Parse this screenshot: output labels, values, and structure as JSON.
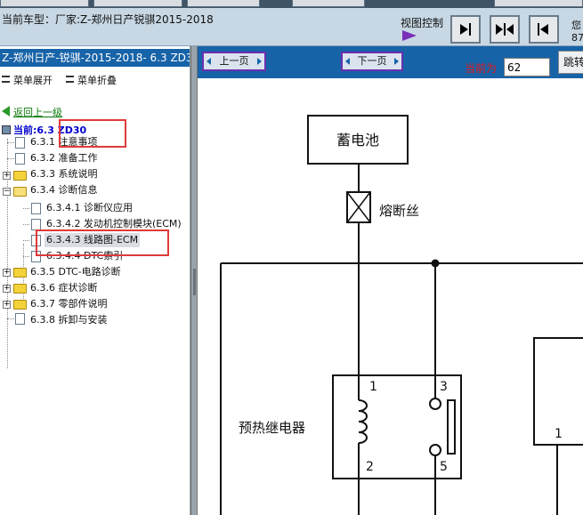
{
  "header": {
    "car_model": "当前车型：厂家:Z-郑州日产锐骐2015-2018",
    "view_control": "视图控制",
    "user_line1": "您",
    "user_line2": "87"
  },
  "sidebar": {
    "breadcrumb": "Z-郑州日产-锐骐-2015-2018- 6.3 ZD30",
    "expand_menu": "菜单展开",
    "collapse_menu": "菜单折叠",
    "back_link": "返回上一级",
    "current": "当前:6.3 ZD30",
    "tree": [
      {
        "label": "6.3.1 注意事项"
      },
      {
        "label": "6.3.2 准备工作"
      },
      {
        "label": "6.3.3 系统说明"
      },
      {
        "label": "6.3.4 诊断信息"
      },
      {
        "label": "6.3.4.1 诊断仪应用"
      },
      {
        "label": "6.3.4.2 发动机控制模块(ECM)"
      },
      {
        "label": "6.3.4.3 线路图-ECM"
      },
      {
        "label": "6.3.4.4 DTC索引"
      },
      {
        "label": "6.3.5 DTC-电路诊断"
      },
      {
        "label": "6.3.6 症状诊断"
      },
      {
        "label": "6.3.7 零部件说明"
      },
      {
        "label": "6.3.8 拆卸与安装"
      }
    ]
  },
  "pager": {
    "prev": "上一页",
    "next": "下一页",
    "current_label": "当前为",
    "current_page": "62",
    "jump": "跳转"
  },
  "diagram": {
    "battery": "蓄电池",
    "fuse": "熔断丝",
    "relay": "预热继电器",
    "pin1": "1",
    "pin2": "2",
    "pin3": "3",
    "pin5": "5",
    "pin_right": "1"
  },
  "colors": {
    "accent_blue": "#1763a8",
    "highlight_red": "#e03a3a",
    "button_border": "#6a2fb0"
  }
}
